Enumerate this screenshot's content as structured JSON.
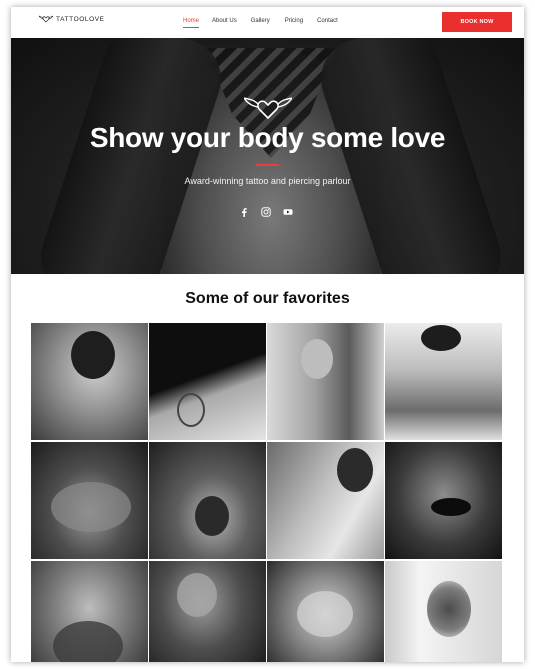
{
  "brand": {
    "name": "TATTOOLOVE"
  },
  "nav": {
    "items": [
      {
        "label": "Home",
        "active": true
      },
      {
        "label": "About Us",
        "active": false
      },
      {
        "label": "Gallery",
        "active": false
      },
      {
        "label": "Pricing",
        "active": false
      },
      {
        "label": "Contact",
        "active": false
      }
    ],
    "cta_label": "BOOK NOW"
  },
  "hero": {
    "title": "Show your body some love",
    "subtitle": "Award-winning tattoo and piercing parlour",
    "socials": [
      "facebook-icon",
      "instagram-icon",
      "youtube-icon"
    ]
  },
  "favorites": {
    "title": "Some of our favorites",
    "photos": [
      "woman-shoulder-tattoo",
      "leg-tattoo-skirt",
      "woman-arm-tattoo-portrait",
      "man-tattooed-bicycle",
      "tattooed-hands-knuckles",
      "woman-arms-raised-tattoo",
      "woman-arm-sleeve-portrait",
      "woman-black-bra-tattoos",
      "man-neck-tattoo",
      "woman-glasses-tattoo",
      "hands-tattoo-closeup",
      "lion-arm-tattoo"
    ]
  },
  "colors": {
    "accent": "#ea2f2f",
    "text": "#111111",
    "hero_bg": "#1c1c1c"
  }
}
